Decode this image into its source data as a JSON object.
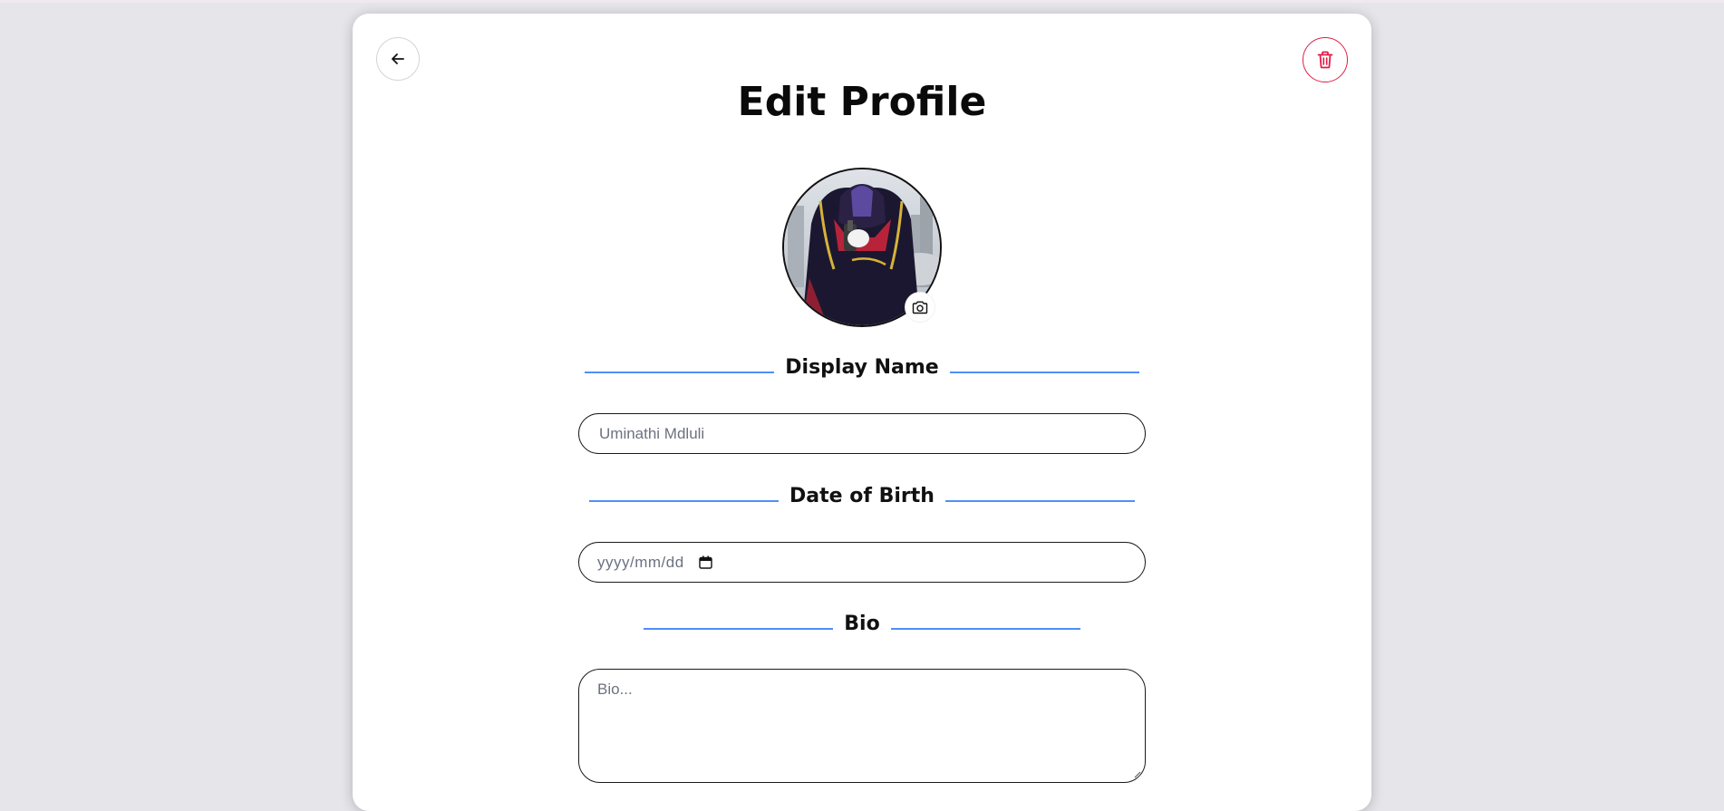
{
  "page": {
    "title": "Edit Profile"
  },
  "header": {
    "back_icon": "arrow-left-icon",
    "delete_icon": "trash-icon",
    "delete_color": "#e11d48"
  },
  "avatar": {
    "camera_icon": "camera-icon"
  },
  "sections": {
    "display_name": {
      "label": "Display Name",
      "placeholder": "Uminathi Mdluli"
    },
    "date_of_birth": {
      "label": "Date of Birth",
      "placeholder": "yyyy/mm/dd",
      "calendar_icon": "calendar-icon"
    },
    "bio": {
      "label": "Bio",
      "placeholder": "Bio..."
    }
  },
  "colors": {
    "accent_line": "#4f8ff7",
    "page_background": "#e5e5ea"
  }
}
